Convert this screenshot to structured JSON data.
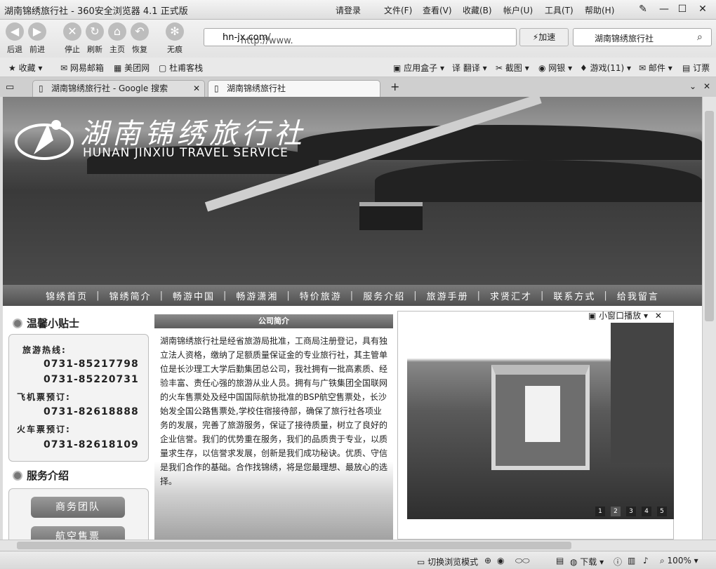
{
  "window": {
    "title": "湖南锦绣旅行社 - 360安全浏览器 4.1 正式版",
    "menu": [
      "请登录",
      "文件(F)",
      "查看(V)",
      "收藏(B)",
      "帐户(U)",
      "工具(T)",
      "帮助(H)"
    ]
  },
  "nav": {
    "back": "后退",
    "forward": "前进",
    "stop": "停止",
    "refresh": "刷新",
    "home": "主页",
    "restore": "恢复",
    "no_trace": "无痕",
    "address": "http://www.hn-jx.com/",
    "address_prefix": "http://www.",
    "address_domain": "hn-jx.com",
    "address_suffix": "/",
    "speed": "加速",
    "search_value": "湖南锦绣旅行社"
  },
  "bookmarks": {
    "left": [
      "收藏",
      "网易邮箱",
      "美团网",
      "杜甫客栈"
    ],
    "right": [
      "应用盒子",
      "翻译",
      "截图",
      "网银",
      "游戏(11)",
      "邮件",
      "订票"
    ]
  },
  "tabs": [
    {
      "label": "湖南锦绣旅行社 - Google 搜索",
      "active": false
    },
    {
      "label": "湖南锦绣旅行社",
      "active": true
    }
  ],
  "site": {
    "logo_cn": "湖南锦绣旅行社",
    "logo_en": "HUNAN JINXIU TRAVEL SERVICE",
    "menu": [
      "锦绣首页",
      "锦绣简介",
      "畅游中国",
      "畅游潇湘",
      "特价旅游",
      "服务介绍",
      "旅游手册",
      "求贤汇才",
      "联系方式",
      "给我留言"
    ],
    "tips_title": "温馨小贴士",
    "hotline_label": "旅游热线:",
    "hotline": [
      "0731-85217798",
      "0731-85220731"
    ],
    "air_label": "飞机票预订:",
    "air": "0731-82618888",
    "train_label": "火车票预订:",
    "train": "0731-82618109",
    "service_title": "服务介绍",
    "service_buttons": [
      "商务团队",
      "航空售票"
    ],
    "intro_title": "公司简介",
    "intro_text": "湖南锦绣旅行社是经省旅游局批准，工商局注册登记，具有独立法人资格，缴纳了足额质量保证金的专业旅行社，其主管单位是长沙理工大学后勤集团总公司，我社拥有一批高素质、经验丰富、责任心强的旅游从业人员。拥有与广铁集团全国联网的火车售票处及经中国国际航协批准的BSP航空售票处，长沙始发全国公路售票处,学校住宿接待部，确保了旅行社各项业务的发展，完善了旅游服务，保证了接待质量，树立了良好的企业信誉。我们的优势重在服务，我们的品质贵于专业，以质量求生存，以信誉求发展，创新是我们成功秘诀。优质、守信是我们合作的基础。合作找锦绣，将是您最理想、最放心的选择。",
    "popup_label": "小窗口播放",
    "pager": [
      "1",
      "2",
      "3",
      "4",
      "5"
    ]
  },
  "status": {
    "mode": "切换浏览模式",
    "download": "下载",
    "zoom": "100%"
  }
}
